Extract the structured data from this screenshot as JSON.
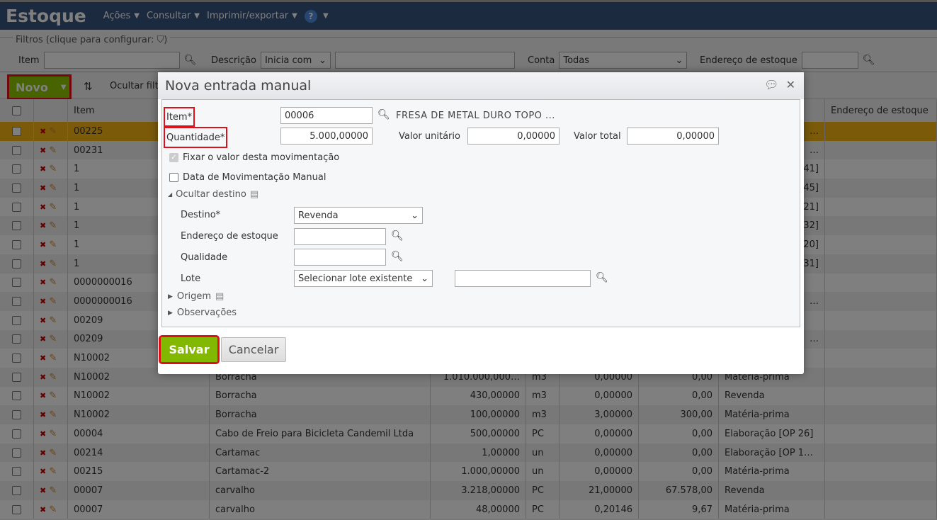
{
  "app": {
    "title": "Estoque",
    "menus": [
      "Ações",
      "Consultar",
      "Imprimir/exportar"
    ],
    "help": "?"
  },
  "filters": {
    "legend": "Filtros (clique para configurar:",
    "legend_end": ")",
    "item_label": "Item",
    "item_value": "",
    "desc_label": "Descrição",
    "desc_mode": "Inicia com",
    "desc_value": "",
    "conta_label": "Conta",
    "conta_value": "Todas",
    "end_label": "Endereço de estoque",
    "end_value": ""
  },
  "toolbar": {
    "novo": "Novo",
    "ocultar": "Ocultar filt"
  },
  "table": {
    "headers": [
      "Item",
      "Endereço de estoque"
    ],
    "rows": [
      {
        "item": "00225",
        "conta": "…",
        "selected": true
      },
      {
        "item": "00231",
        "conta": "…"
      },
      {
        "item": "1",
        "conta": "41]"
      },
      {
        "item": "1",
        "conta": "45]"
      },
      {
        "item": "1",
        "conta": "21]"
      },
      {
        "item": "1",
        "conta": "32]"
      },
      {
        "item": "1",
        "conta": "20]"
      },
      {
        "item": "1",
        "conta": "31]"
      },
      {
        "item": "0000000016",
        "conta": ""
      },
      {
        "item": "0000000016",
        "conta": "…"
      },
      {
        "item": "00209",
        "conta": ""
      },
      {
        "item": "00209",
        "conta": "…"
      },
      {
        "item": "N10002",
        "conta": ""
      },
      {
        "item": "N10002",
        "desc": "Borracha",
        "qty": "1.010.000,000…",
        "unit": "m3",
        "vu": "0,00000",
        "vt": "0,00",
        "conta": "Matéria-prima"
      },
      {
        "item": "N10002",
        "desc": "Borracha",
        "qty": "430,00000",
        "unit": "m3",
        "vu": "0,00000",
        "vt": "0,00",
        "conta": "Revenda"
      },
      {
        "item": "N10002",
        "desc": "Borracha",
        "qty": "100,00000",
        "unit": "m3",
        "vu": "3,00000",
        "vt": "300,00",
        "conta": "Matéria-prima"
      },
      {
        "item": "00004",
        "desc": "Cabo de Freio para Bicicleta Candemil Ltda",
        "qty": "500,00000",
        "unit": "PC",
        "vu": "0,00000",
        "vt": "0,00",
        "conta": "Elaboração [OP 26]"
      },
      {
        "item": "00214",
        "desc": "Cartamac",
        "qty": "1,00000",
        "unit": "un",
        "vu": "0,00000",
        "vt": "0,00",
        "conta": "Elaboração [OP 1…"
      },
      {
        "item": "00215",
        "desc": "Cartamac-2",
        "qty": "1.000,00000",
        "unit": "un",
        "vu": "0,00000",
        "vt": "0,00",
        "conta": "Matéria-prima"
      },
      {
        "item": "00007",
        "desc": "carvalho",
        "qty": "3.218,00000",
        "unit": "PC",
        "vu": "21,00000",
        "vt": "67.578,00",
        "conta": "Revenda"
      },
      {
        "item": "00007",
        "desc": "carvalho",
        "qty": "48,00000",
        "unit": "PC",
        "vu": "0,20146",
        "vt": "9,67",
        "conta": "Matéria-prima"
      }
    ]
  },
  "modal": {
    "title": "Nova entrada manual",
    "item_label": "Item*",
    "item_value": "00006",
    "item_desc": "FRESA DE METAL DURO TOPO ...",
    "qty_label": "Quantidade*",
    "qty_value": "5.000,00000",
    "vu_label": "Valor unitário",
    "vu_value": "0,00000",
    "vt_label": "Valor total",
    "vt_value": "0,00000",
    "fixar_label": "Fixar o valor desta movimentação",
    "data_label": "Data de Movimentação Manual",
    "ocultar_destino": "Ocultar destino",
    "destino_label": "Destino*",
    "destino_value": "Revenda",
    "endereco_label": "Endereço de estoque",
    "endereco_value": "",
    "qualidade_label": "Qualidade",
    "qualidade_value": "",
    "lote_label": "Lote",
    "lote_mode": "Selecionar lote existente",
    "lote_value": "",
    "origem": "Origem",
    "observacoes": "Observações",
    "salvar": "Salvar",
    "cancelar": "Cancelar"
  },
  "colors": {
    "accent": "#90c800",
    "header": "#36557e",
    "selected_row": "#f6b414",
    "highlight": "#e0101a"
  }
}
